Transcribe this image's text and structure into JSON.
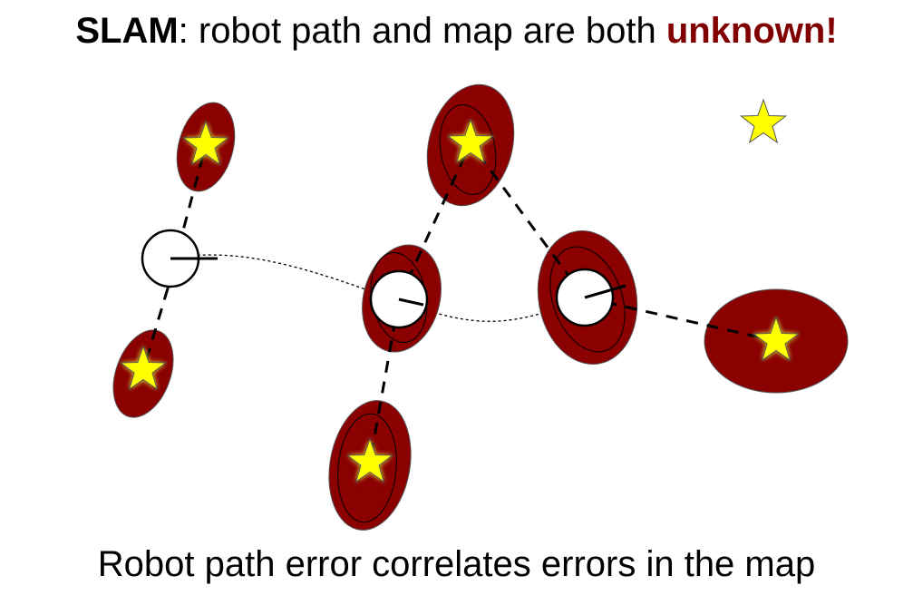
{
  "title": {
    "bold_word": "SLAM",
    "rest": ": robot path and map are both ",
    "highlight": "unknown!"
  },
  "caption": "Robot path error correlates errors in the map",
  "colors": {
    "uncertainty_fill": "#8b0000",
    "highlight_text": "#800000",
    "star_fill": "#ffff00",
    "robot_fill": "#ffffff",
    "line": "#000000"
  },
  "icons": [
    "star-icon",
    "robot-pose-icon",
    "uncertainty-ellipse"
  ]
}
